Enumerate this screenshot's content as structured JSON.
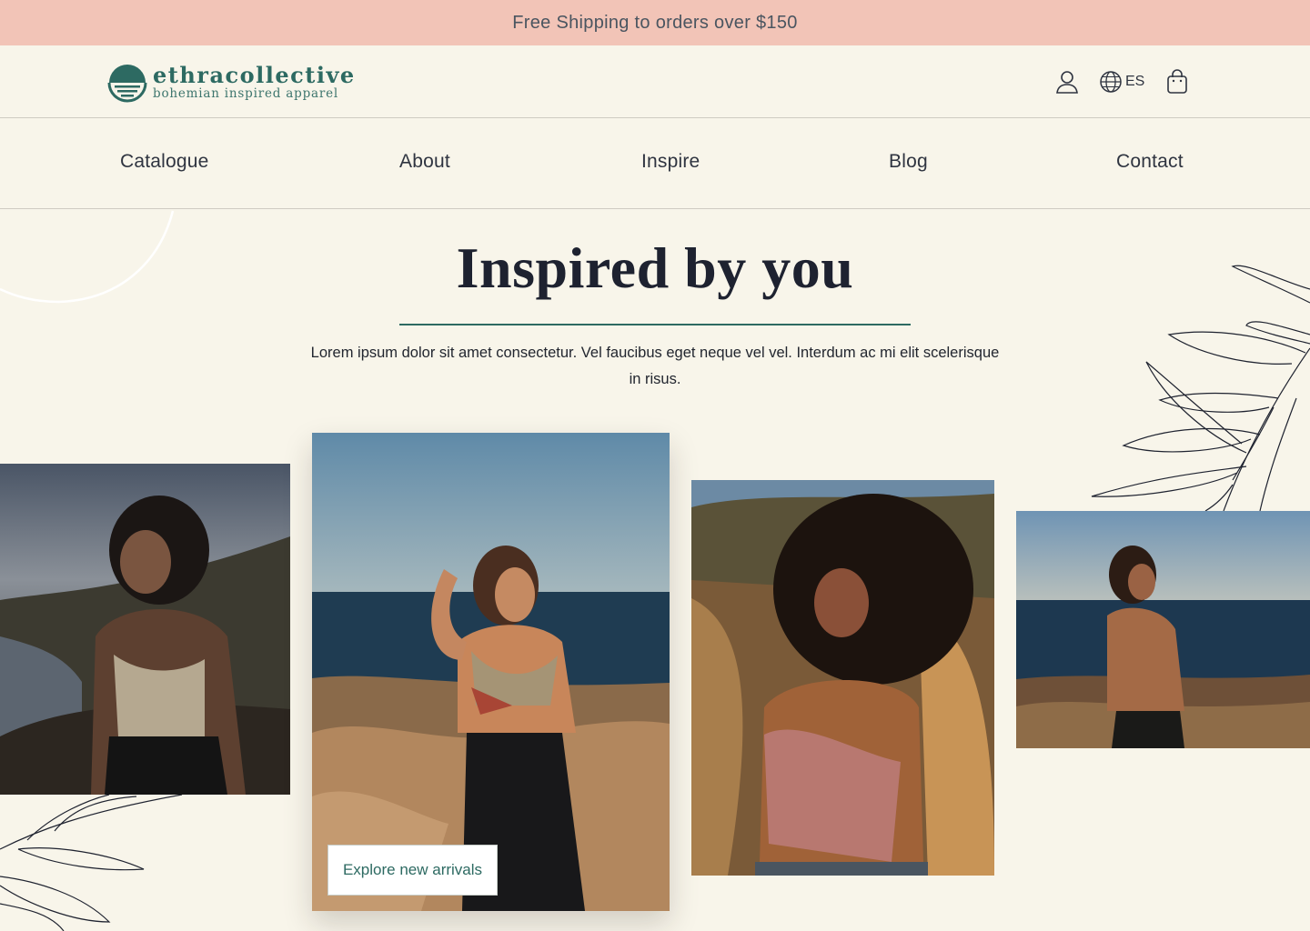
{
  "announcement": "Free Shipping to orders over $150",
  "brand": {
    "name": "ethracollective",
    "tagline": "bohemian inspired apparel",
    "color": "#2d6a62"
  },
  "header": {
    "account_icon": "user-icon",
    "language_icon": "globe-icon",
    "language": "ES",
    "cart_icon": "shopping-bag-icon"
  },
  "nav": [
    "Catalogue",
    "About",
    "Inspire",
    "Blog",
    "Contact"
  ],
  "hero": {
    "title": "Inspired by you",
    "description": "Lorem ipsum dolor sit amet consectetur. Vel faucibus eget neque vel vel. Interdum ac mi elit scelerisque in risus."
  },
  "gallery_cta": "Explore new arrivals",
  "colors": {
    "announcement_bg": "#f2c4b7",
    "page_bg": "#f8f5ea",
    "accent": "#2d6a62"
  }
}
